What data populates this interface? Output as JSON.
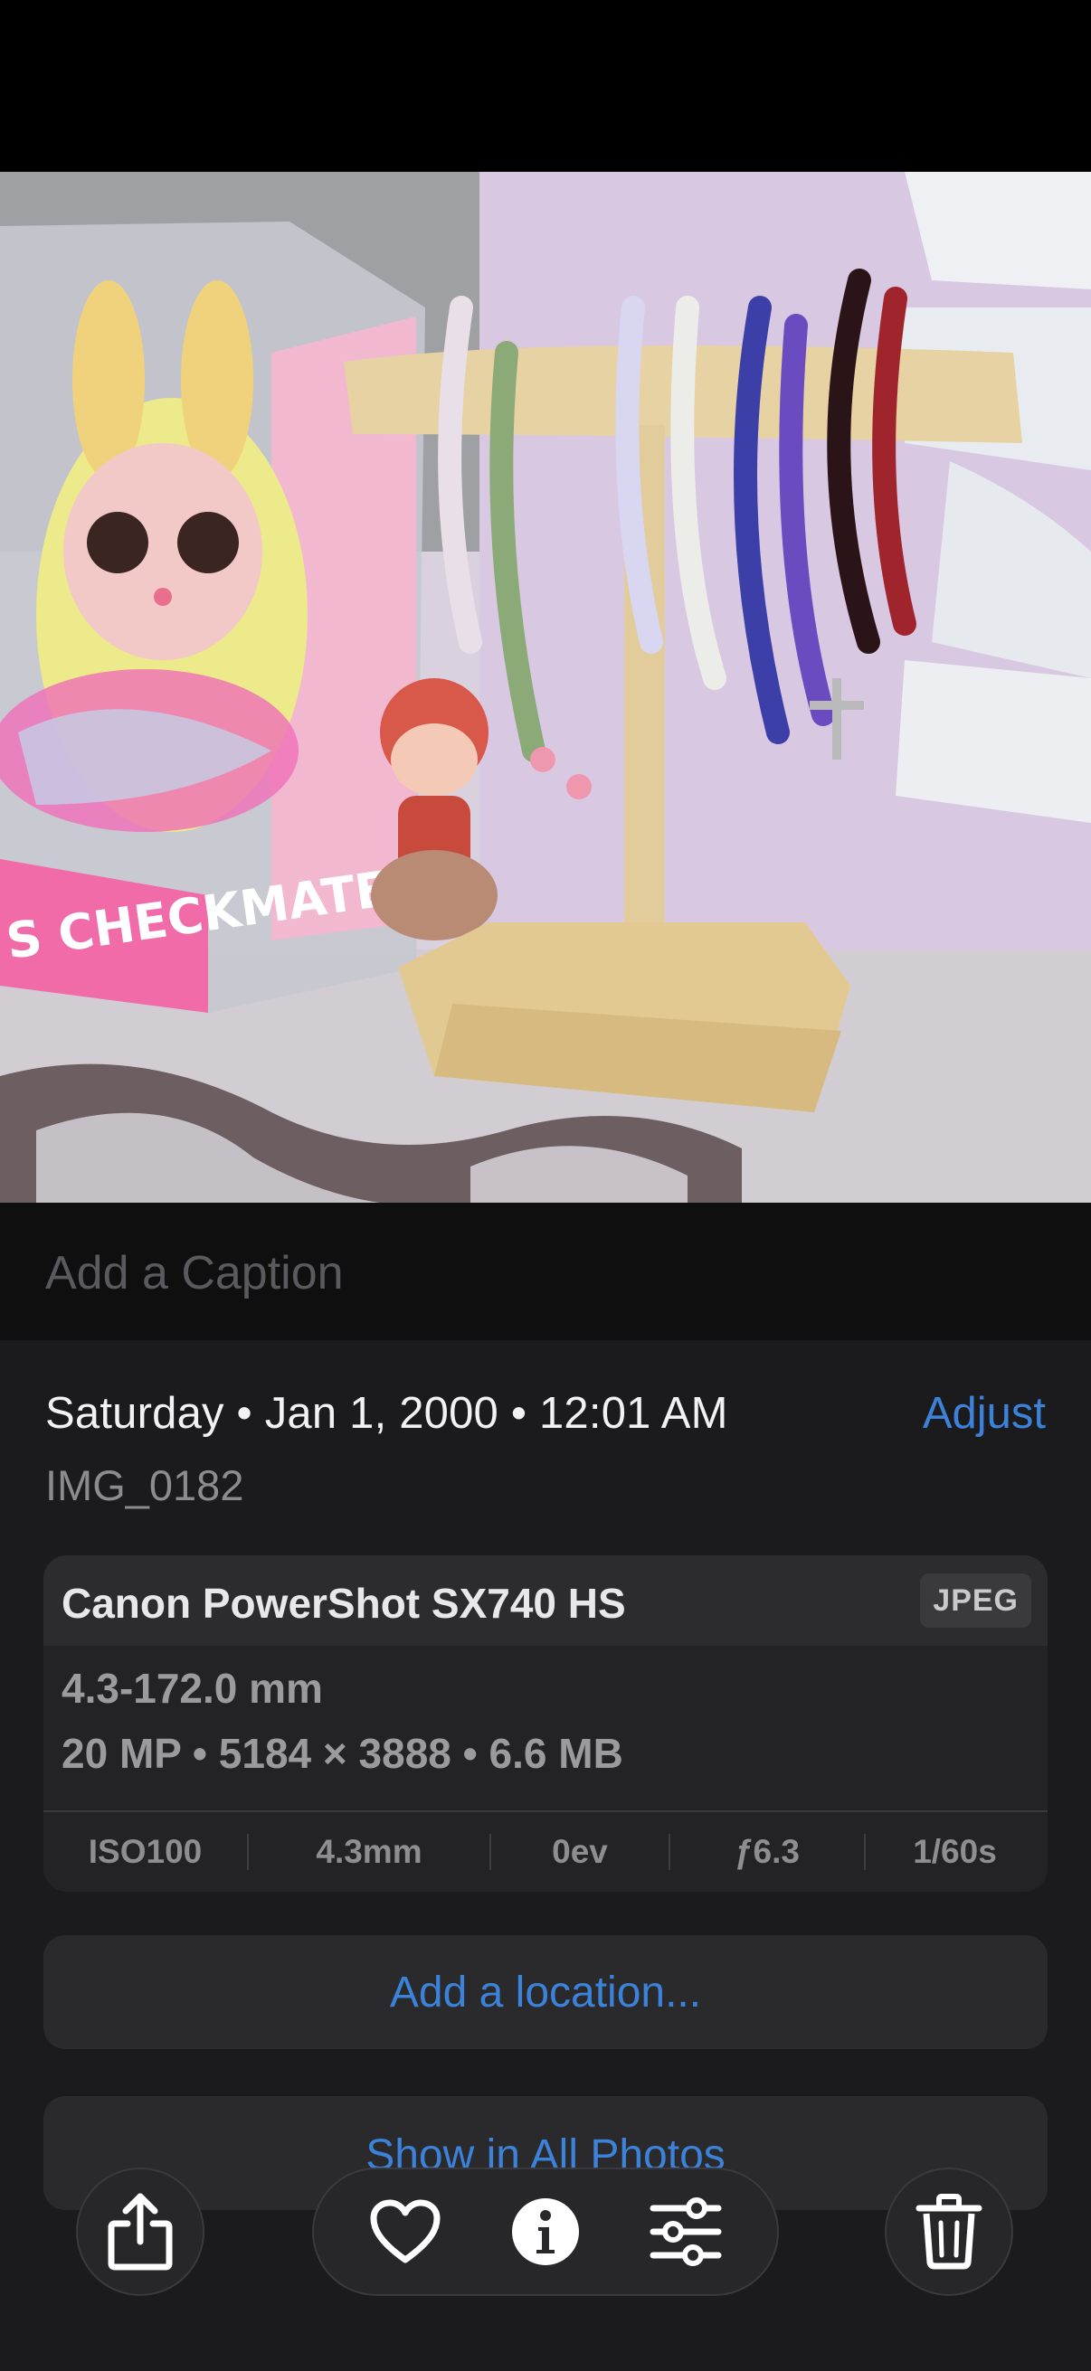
{
  "caption": {
    "placeholder": "Add a Caption"
  },
  "info": {
    "date_line": "Saturday • Jan 1, 2000 • 12:01 AM",
    "adjust_label": "Adjust",
    "filename": "IMG_0182"
  },
  "camera": {
    "name": "Canon PowerShot SX740 HS",
    "format": "JPEG",
    "lens": "4.3-172.0 mm",
    "specs": "20 MP • 5184 × 3888 • 6.6 MB",
    "exif": {
      "iso": "ISO100",
      "focal": "4.3mm",
      "ev": "0ev",
      "aperture": "ƒ6.3",
      "shutter": "1/60s"
    }
  },
  "actions": {
    "add_location": "Add a location...",
    "show_all_photos": "Show in All Photos"
  },
  "toolbar": {
    "icons": [
      "share-icon",
      "heart-icon",
      "info-icon",
      "sliders-icon",
      "trash-icon"
    ]
  },
  "colors": {
    "accent": "#3b82d8",
    "sheet_bg": "#1b1b1d",
    "card_bg": "#232326"
  }
}
